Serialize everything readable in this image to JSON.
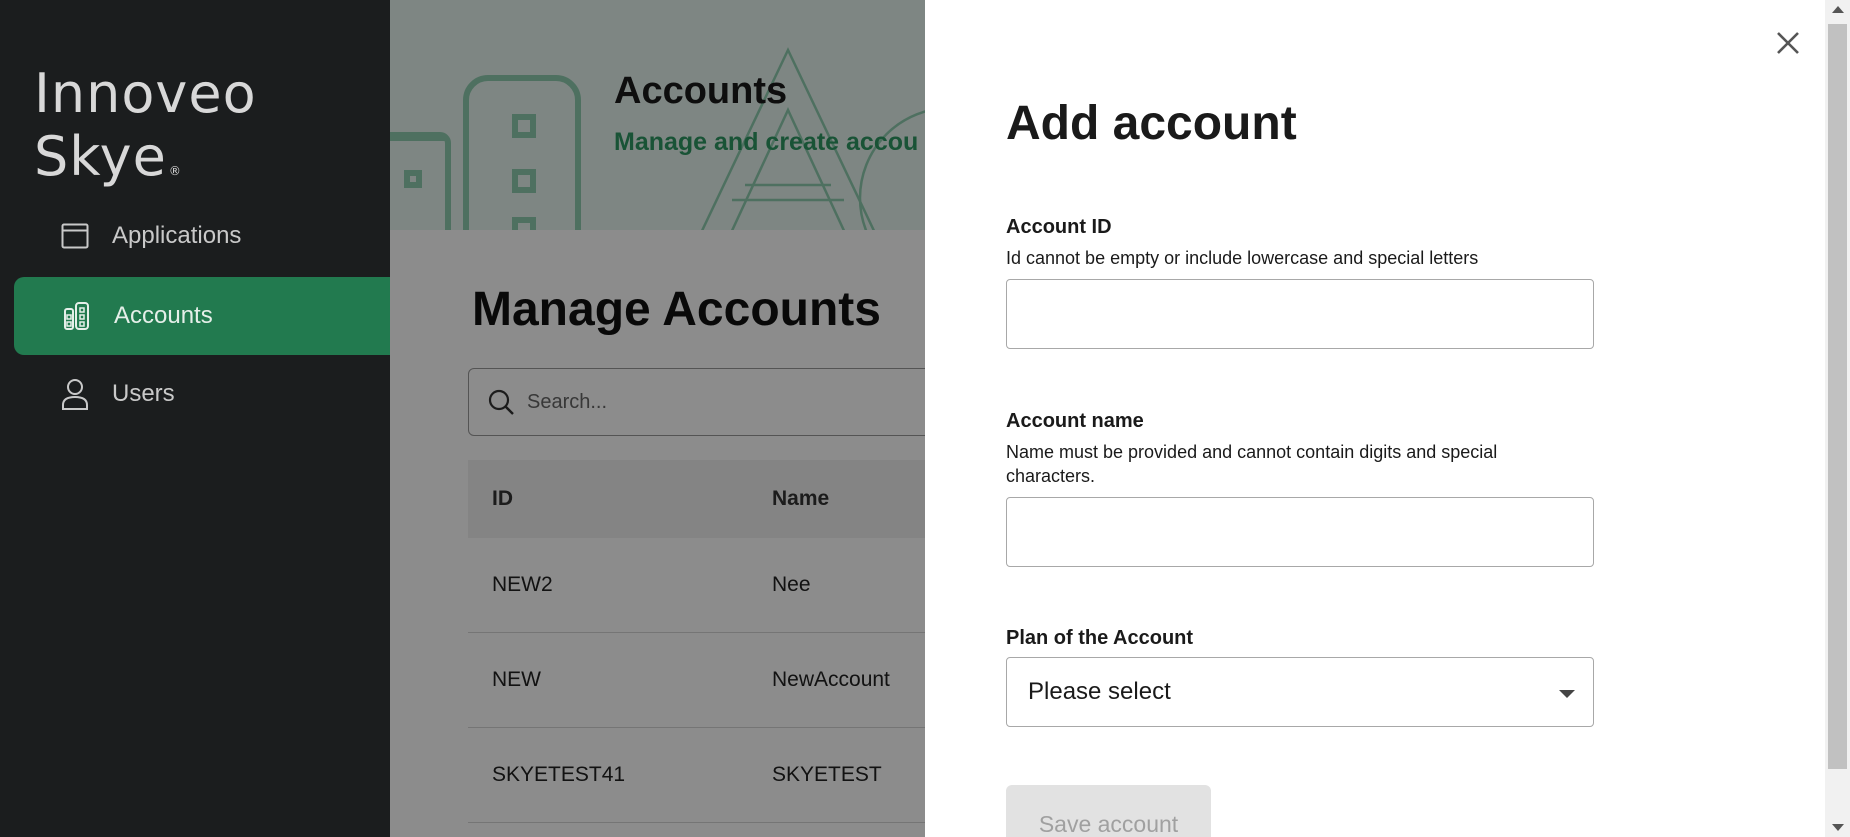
{
  "sidebar": {
    "brand": "Innoveo Skye",
    "brand_mark": "®",
    "items": [
      {
        "label": "Applications",
        "icon": "window-icon",
        "active": false
      },
      {
        "label": "Accounts",
        "icon": "accounts-icon",
        "active": true
      },
      {
        "label": "Users",
        "icon": "user-icon",
        "active": false
      }
    ]
  },
  "header": {
    "title": "Accounts",
    "subtitle": "Manage and create accou"
  },
  "main": {
    "title": "Manage Accounts",
    "search_placeholder": "Search...",
    "table": {
      "columns": [
        "ID",
        "Name"
      ],
      "rows": [
        [
          "NEW2",
          "Nee"
        ],
        [
          "NEW",
          "NewAccount"
        ],
        [
          "SKYETEST41",
          "SKYETEST"
        ]
      ]
    }
  },
  "drawer": {
    "title": "Add account",
    "account_id": {
      "label": "Account ID",
      "help": "Id cannot be empty or include lowercase and special letters",
      "value": ""
    },
    "account_name": {
      "label": "Account name",
      "help": "Name must be provided and cannot contain digits and special characters.",
      "value": ""
    },
    "plan": {
      "label": "Plan of the Account",
      "selected": "Please select"
    },
    "save_label": "Save account",
    "close_icon": "close-icon"
  },
  "colors": {
    "sidebar_bg": "#1b1d1e",
    "accent": "#227a4f",
    "hero_bg": "#e6f4ee",
    "hero_subtitle": "#2e9863"
  }
}
